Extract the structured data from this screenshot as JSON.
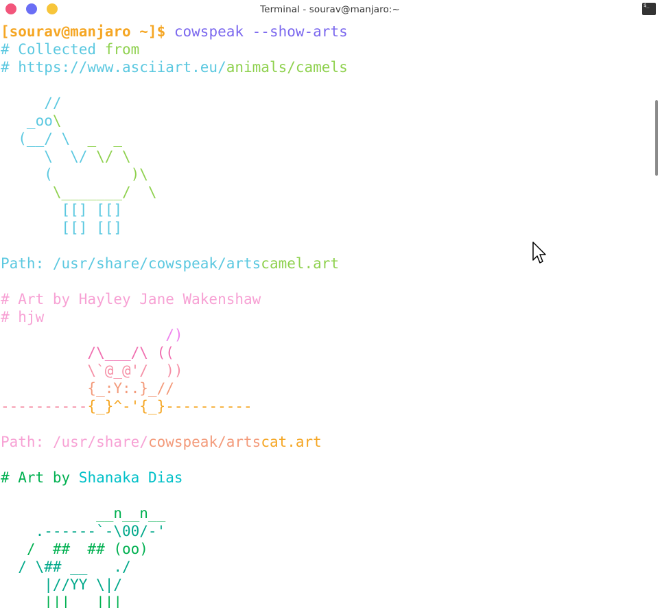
{
  "window": {
    "title": "Terminal - sourav@manjaro:~",
    "icon": "terminal-icon",
    "term_glyph": "$_"
  },
  "terminal": {
    "lines": [
      {
        "parts": [
          {
            "text": "[sourav@manjaro ~]$ ",
            "color": "#f5a623",
            "bold": true
          },
          {
            "text": "cowspeak --show-arts",
            "color": "#7b68ee"
          }
        ]
      },
      {
        "parts": [
          {
            "text": "# Collected ",
            "color": "#5bc8e0"
          },
          {
            "text": "from",
            "color": "#8fd14f"
          }
        ]
      },
      {
        "parts": [
          {
            "text": "# https://www.asciiart.eu/",
            "color": "#5bc8e0"
          },
          {
            "text": "animals/camels",
            "color": "#8fd14f"
          }
        ]
      },
      {
        "parts": []
      },
      {
        "parts": [
          {
            "text": "     //",
            "color": "#5bc8e0"
          }
        ]
      },
      {
        "parts": [
          {
            "text": "   _oo",
            "color": "#5bc8e0"
          },
          {
            "text": "\\",
            "color": "#8fd14f"
          }
        ]
      },
      {
        "parts": [
          {
            "text": "  (__/ \\  ",
            "color": "#5bc8e0"
          },
          {
            "text": "_  _",
            "color": "#8fd14f"
          }
        ]
      },
      {
        "parts": [
          {
            "text": "     \\  \\/ ",
            "color": "#5bc8e0"
          },
          {
            "text": "\\/ \\",
            "color": "#8fd14f"
          }
        ]
      },
      {
        "parts": [
          {
            "text": "     (         ",
            "color": "#5bc8e0"
          },
          {
            "text": ")\\",
            "color": "#8fd14f"
          }
        ]
      },
      {
        "parts": [
          {
            "text": "      \\_______/  \\",
            "color": "#8fd14f"
          }
        ]
      },
      {
        "parts": [
          {
            "text": "       [[] [[]",
            "color": "#5bc8e0"
          }
        ]
      },
      {
        "parts": [
          {
            "text": "       [[] [[]",
            "color": "#5bc8e0"
          }
        ]
      },
      {
        "parts": []
      },
      {
        "parts": [
          {
            "text": "Path: /usr/share/cowspeak/arts",
            "color": "#5bc8e0"
          },
          {
            "text": "camel.art",
            "color": "#8fd14f"
          }
        ]
      },
      {
        "parts": []
      },
      {
        "parts": [
          {
            "text": "# Art by Hayley Jane Wakenshaw",
            "color": "#f7a1d4"
          }
        ]
      },
      {
        "parts": [
          {
            "text": "# hjw",
            "color": "#f7a1d4"
          }
        ]
      },
      {
        "parts": [
          {
            "text": "                   /)",
            "color": "#ee82ee"
          }
        ]
      },
      {
        "parts": [
          {
            "text": "          /\\___/\\ ((",
            "color": "#f06fb0"
          }
        ]
      },
      {
        "parts": [
          {
            "text": "          \\`@_@'/  ))",
            "color": "#f58fa6"
          }
        ]
      },
      {
        "parts": [
          {
            "text": "          {_:Y:.}_//",
            "color": "#f39a7a"
          }
        ]
      },
      {
        "parts": [
          {
            "text": "----------",
            "color": "#f58fa6"
          },
          {
            "text": "{_}^-'{_}----------",
            "color": "#f5a623"
          }
        ]
      },
      {
        "parts": []
      },
      {
        "parts": [
          {
            "text": "Path: /usr/share/",
            "color": "#f7a1d4"
          },
          {
            "text": "cowspeak/arts",
            "color": "#f39a7a"
          },
          {
            "text": "cat.art",
            "color": "#f5a623"
          }
        ]
      },
      {
        "parts": []
      },
      {
        "parts": [
          {
            "text": "# Art by ",
            "color": "#00b050"
          },
          {
            "text": "Shanaka Dias",
            "color": "#00c0c8"
          }
        ]
      },
      {
        "parts": []
      },
      {
        "parts": [
          {
            "text": "           __n__n__",
            "color": "#00b050"
          }
        ]
      },
      {
        "parts": [
          {
            "text": "    .------`-\\00/-'",
            "color": "#00a88a"
          }
        ]
      },
      {
        "parts": [
          {
            "text": "   /  ##  ## (oo)",
            "color": "#00b050"
          }
        ]
      },
      {
        "parts": [
          {
            "text": "  / \\## __   ./",
            "color": "#00a88a"
          }
        ]
      },
      {
        "parts": [
          {
            "text": "     |//YY \\|/",
            "color": "#00a88a"
          }
        ]
      },
      {
        "parts": [
          {
            "text": "     |||   |||",
            "color": "#00b050"
          }
        ]
      }
    ]
  }
}
